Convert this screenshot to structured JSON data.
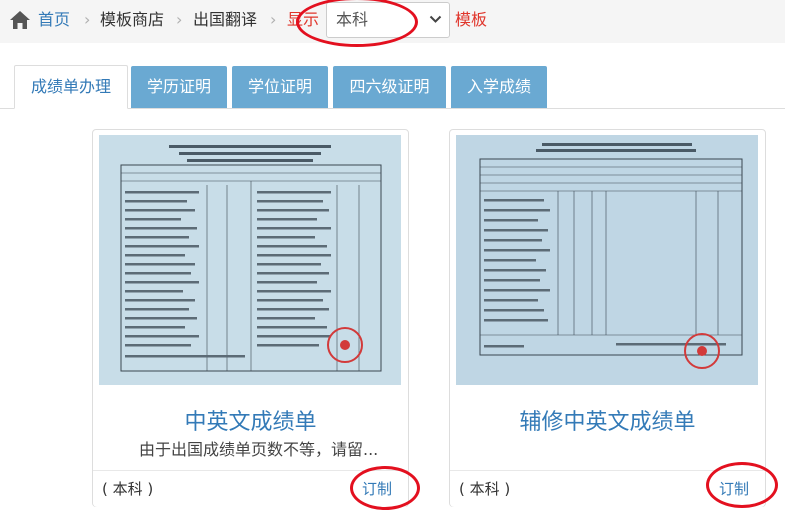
{
  "breadcrumb": {
    "home": "首页",
    "separator": "›",
    "store": "模板商店",
    "category": "出国翻译",
    "show_label": "显示",
    "level_selected": "本科",
    "template_label": "模板"
  },
  "tabs": [
    {
      "label": "成绩单办理"
    },
    {
      "label": "学历证明"
    },
    {
      "label": "学位证明"
    },
    {
      "label": "四六级证明"
    },
    {
      "label": "入学成绩"
    }
  ],
  "cards": [
    {
      "title": "中英文成绩单",
      "desc": "由于出国成绩单页数不等，请留...",
      "level": "( 本科 )",
      "order_label": "订制"
    },
    {
      "title": "辅修中英文成绩单",
      "desc": "",
      "level": "( 本科 )",
      "order_label": "订制"
    }
  ],
  "colors": {
    "accent": "#337ab7",
    "tab_bg": "#6aa9d2",
    "highlight": "#e3101f",
    "show_label": "#e0352b"
  },
  "icons": {
    "home": "home-icon",
    "select": "chevron-down-icon"
  }
}
